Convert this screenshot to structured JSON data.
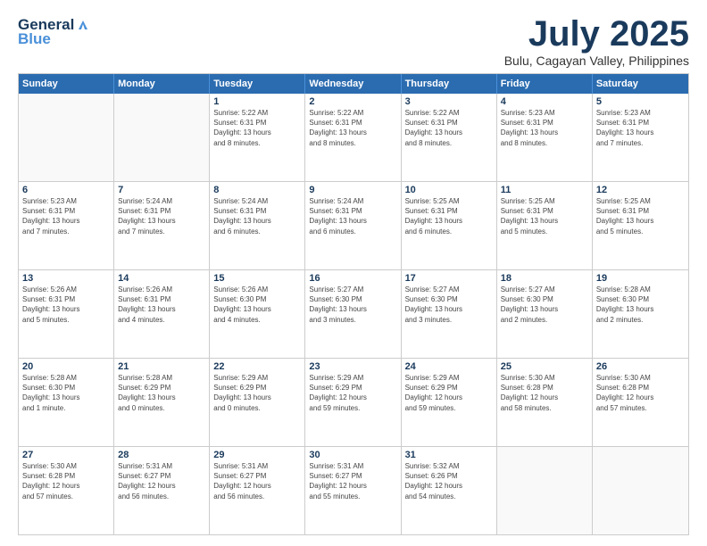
{
  "logo": {
    "line1": "General",
    "line2": "Blue"
  },
  "title": "July 2025",
  "subtitle": "Bulu, Cagayan Valley, Philippines",
  "header_days": [
    "Sunday",
    "Monday",
    "Tuesday",
    "Wednesday",
    "Thursday",
    "Friday",
    "Saturday"
  ],
  "weeks": [
    [
      {
        "day": "",
        "info": ""
      },
      {
        "day": "",
        "info": ""
      },
      {
        "day": "1",
        "info": "Sunrise: 5:22 AM\nSunset: 6:31 PM\nDaylight: 13 hours\nand 8 minutes."
      },
      {
        "day": "2",
        "info": "Sunrise: 5:22 AM\nSunset: 6:31 PM\nDaylight: 13 hours\nand 8 minutes."
      },
      {
        "day": "3",
        "info": "Sunrise: 5:22 AM\nSunset: 6:31 PM\nDaylight: 13 hours\nand 8 minutes."
      },
      {
        "day": "4",
        "info": "Sunrise: 5:23 AM\nSunset: 6:31 PM\nDaylight: 13 hours\nand 8 minutes."
      },
      {
        "day": "5",
        "info": "Sunrise: 5:23 AM\nSunset: 6:31 PM\nDaylight: 13 hours\nand 7 minutes."
      }
    ],
    [
      {
        "day": "6",
        "info": "Sunrise: 5:23 AM\nSunset: 6:31 PM\nDaylight: 13 hours\nand 7 minutes."
      },
      {
        "day": "7",
        "info": "Sunrise: 5:24 AM\nSunset: 6:31 PM\nDaylight: 13 hours\nand 7 minutes."
      },
      {
        "day": "8",
        "info": "Sunrise: 5:24 AM\nSunset: 6:31 PM\nDaylight: 13 hours\nand 6 minutes."
      },
      {
        "day": "9",
        "info": "Sunrise: 5:24 AM\nSunset: 6:31 PM\nDaylight: 13 hours\nand 6 minutes."
      },
      {
        "day": "10",
        "info": "Sunrise: 5:25 AM\nSunset: 6:31 PM\nDaylight: 13 hours\nand 6 minutes."
      },
      {
        "day": "11",
        "info": "Sunrise: 5:25 AM\nSunset: 6:31 PM\nDaylight: 13 hours\nand 5 minutes."
      },
      {
        "day": "12",
        "info": "Sunrise: 5:25 AM\nSunset: 6:31 PM\nDaylight: 13 hours\nand 5 minutes."
      }
    ],
    [
      {
        "day": "13",
        "info": "Sunrise: 5:26 AM\nSunset: 6:31 PM\nDaylight: 13 hours\nand 5 minutes."
      },
      {
        "day": "14",
        "info": "Sunrise: 5:26 AM\nSunset: 6:31 PM\nDaylight: 13 hours\nand 4 minutes."
      },
      {
        "day": "15",
        "info": "Sunrise: 5:26 AM\nSunset: 6:30 PM\nDaylight: 13 hours\nand 4 minutes."
      },
      {
        "day": "16",
        "info": "Sunrise: 5:27 AM\nSunset: 6:30 PM\nDaylight: 13 hours\nand 3 minutes."
      },
      {
        "day": "17",
        "info": "Sunrise: 5:27 AM\nSunset: 6:30 PM\nDaylight: 13 hours\nand 3 minutes."
      },
      {
        "day": "18",
        "info": "Sunrise: 5:27 AM\nSunset: 6:30 PM\nDaylight: 13 hours\nand 2 minutes."
      },
      {
        "day": "19",
        "info": "Sunrise: 5:28 AM\nSunset: 6:30 PM\nDaylight: 13 hours\nand 2 minutes."
      }
    ],
    [
      {
        "day": "20",
        "info": "Sunrise: 5:28 AM\nSunset: 6:30 PM\nDaylight: 13 hours\nand 1 minute."
      },
      {
        "day": "21",
        "info": "Sunrise: 5:28 AM\nSunset: 6:29 PM\nDaylight: 13 hours\nand 0 minutes."
      },
      {
        "day": "22",
        "info": "Sunrise: 5:29 AM\nSunset: 6:29 PM\nDaylight: 13 hours\nand 0 minutes."
      },
      {
        "day": "23",
        "info": "Sunrise: 5:29 AM\nSunset: 6:29 PM\nDaylight: 12 hours\nand 59 minutes."
      },
      {
        "day": "24",
        "info": "Sunrise: 5:29 AM\nSunset: 6:29 PM\nDaylight: 12 hours\nand 59 minutes."
      },
      {
        "day": "25",
        "info": "Sunrise: 5:30 AM\nSunset: 6:28 PM\nDaylight: 12 hours\nand 58 minutes."
      },
      {
        "day": "26",
        "info": "Sunrise: 5:30 AM\nSunset: 6:28 PM\nDaylight: 12 hours\nand 57 minutes."
      }
    ],
    [
      {
        "day": "27",
        "info": "Sunrise: 5:30 AM\nSunset: 6:28 PM\nDaylight: 12 hours\nand 57 minutes."
      },
      {
        "day": "28",
        "info": "Sunrise: 5:31 AM\nSunset: 6:27 PM\nDaylight: 12 hours\nand 56 minutes."
      },
      {
        "day": "29",
        "info": "Sunrise: 5:31 AM\nSunset: 6:27 PM\nDaylight: 12 hours\nand 56 minutes."
      },
      {
        "day": "30",
        "info": "Sunrise: 5:31 AM\nSunset: 6:27 PM\nDaylight: 12 hours\nand 55 minutes."
      },
      {
        "day": "31",
        "info": "Sunrise: 5:32 AM\nSunset: 6:26 PM\nDaylight: 12 hours\nand 54 minutes."
      },
      {
        "day": "",
        "info": ""
      },
      {
        "day": "",
        "info": ""
      }
    ]
  ]
}
